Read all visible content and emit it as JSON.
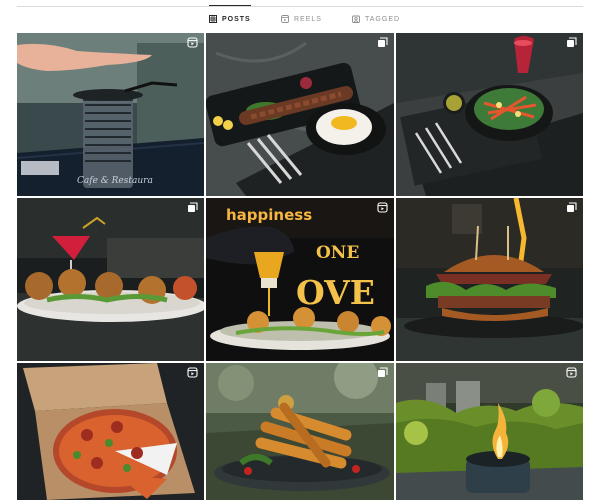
{
  "tabs": [
    {
      "label": "POSTS",
      "icon": "grid-icon",
      "active": true
    },
    {
      "label": "REELS",
      "icon": "reels-icon",
      "active": false
    },
    {
      "label": "TAGGED",
      "icon": "tag-icon",
      "active": false
    }
  ],
  "posts": [
    {
      "type": "reel",
      "badge": "reels-icon"
    },
    {
      "type": "carousel",
      "badge": "carousel-icon"
    },
    {
      "type": "carousel",
      "badge": "carousel-icon"
    },
    {
      "type": "carousel",
      "badge": "carousel-icon"
    },
    {
      "type": "reel",
      "badge": "reels-icon"
    },
    {
      "type": "carousel",
      "badge": "carousel-icon"
    },
    {
      "type": "reel",
      "badge": "reels-icon"
    },
    {
      "type": "carousel",
      "badge": "carousel-icon"
    },
    {
      "type": "reel",
      "badge": "reels-icon"
    }
  ],
  "overlay_text": {
    "cafe_sign": "Cafe & Restaura",
    "sign_word_1": "ONE",
    "sign_word_2": "OVE",
    "neon_text": "happiness"
  },
  "colors": {
    "active_tab": "#262626",
    "inactive_tab": "#8e8e8e",
    "divider": "#dbdbdb"
  }
}
